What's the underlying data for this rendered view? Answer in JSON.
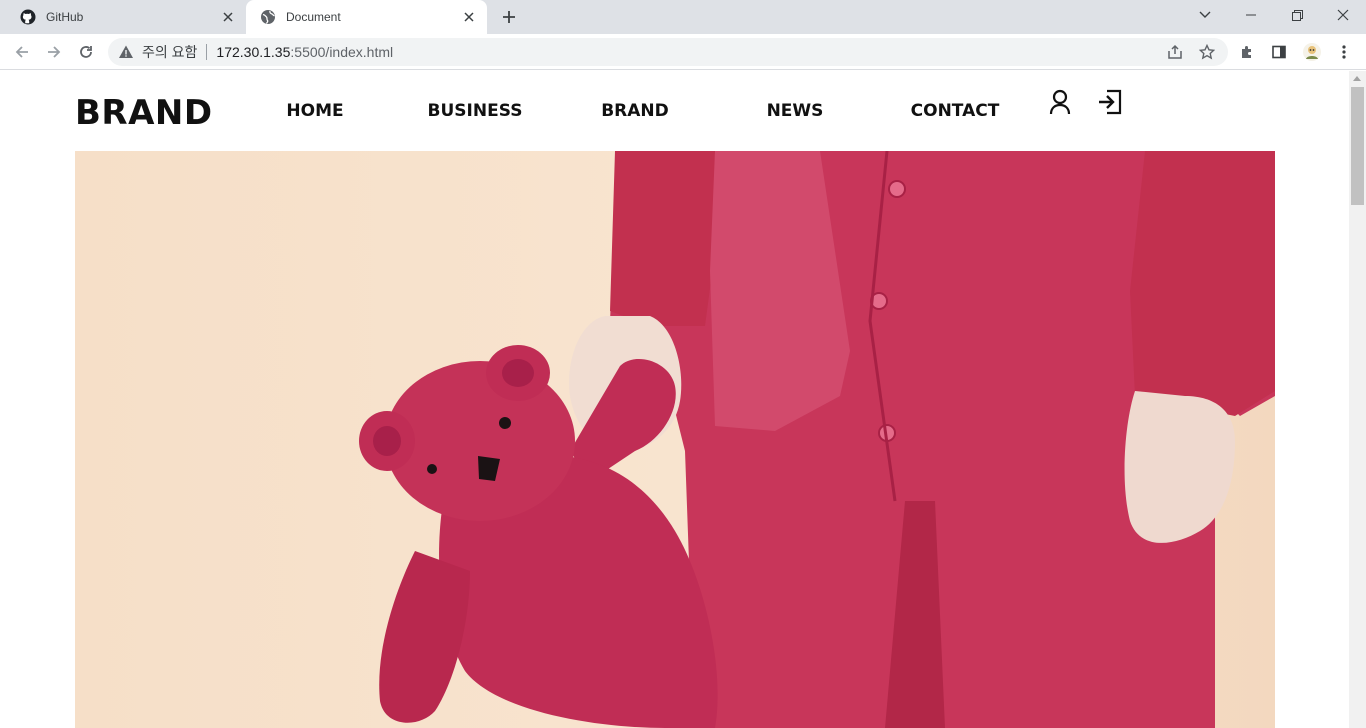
{
  "browser": {
    "tabs": [
      {
        "title": "GitHub",
        "icon": "github-icon",
        "active": false
      },
      {
        "title": "Document",
        "icon": "globe-icon",
        "active": true
      }
    ],
    "address_bar": {
      "security_label": "주의 요함",
      "host": "172.30.1.35",
      "path": ":5500/index.html"
    }
  },
  "site": {
    "brand": "BRAND",
    "nav": [
      "HOME",
      "BUSINESS",
      "BRAND",
      "NEWS",
      "CONTACT"
    ],
    "header_icons": [
      "user-icon",
      "login-icon"
    ]
  },
  "hero": {
    "description_icon": "teddy-bear-photo",
    "colors": {
      "background": "#f7e2cc",
      "garment": "#c8365a",
      "bear": "#c02d55"
    }
  }
}
